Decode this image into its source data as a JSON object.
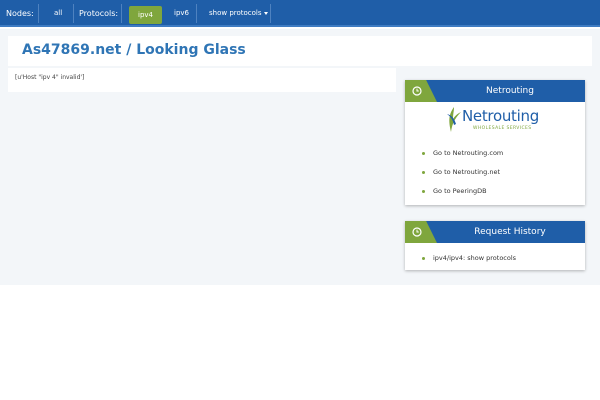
{
  "nav": {
    "nodes_label": "Nodes:",
    "nodes_all": "all",
    "protocols_label": "Protocols:",
    "ipv4": "ipv4",
    "ipv6": "ipv6",
    "show_protocols": "show protocols"
  },
  "page": {
    "title": "As47869.net / Looking Glass",
    "error": "[u'Host \"ipv 4\" invalid']"
  },
  "sidebar": {
    "netrouting": {
      "title": "Netrouting",
      "logo_text": "Netrouting",
      "logo_subtext": "WHOLESALE SERVICES",
      "links": [
        "Go to Netrouting.com",
        "Go to Netrouting.net",
        "Go to PeeringDB"
      ]
    },
    "history": {
      "title": "Request History",
      "items": [
        "ipv4/ipv4: show protocols"
      ]
    }
  },
  "colors": {
    "nav_blue": "#1f5ea8",
    "accent_green": "#7fa63d",
    "title_blue": "#2f75b5"
  }
}
